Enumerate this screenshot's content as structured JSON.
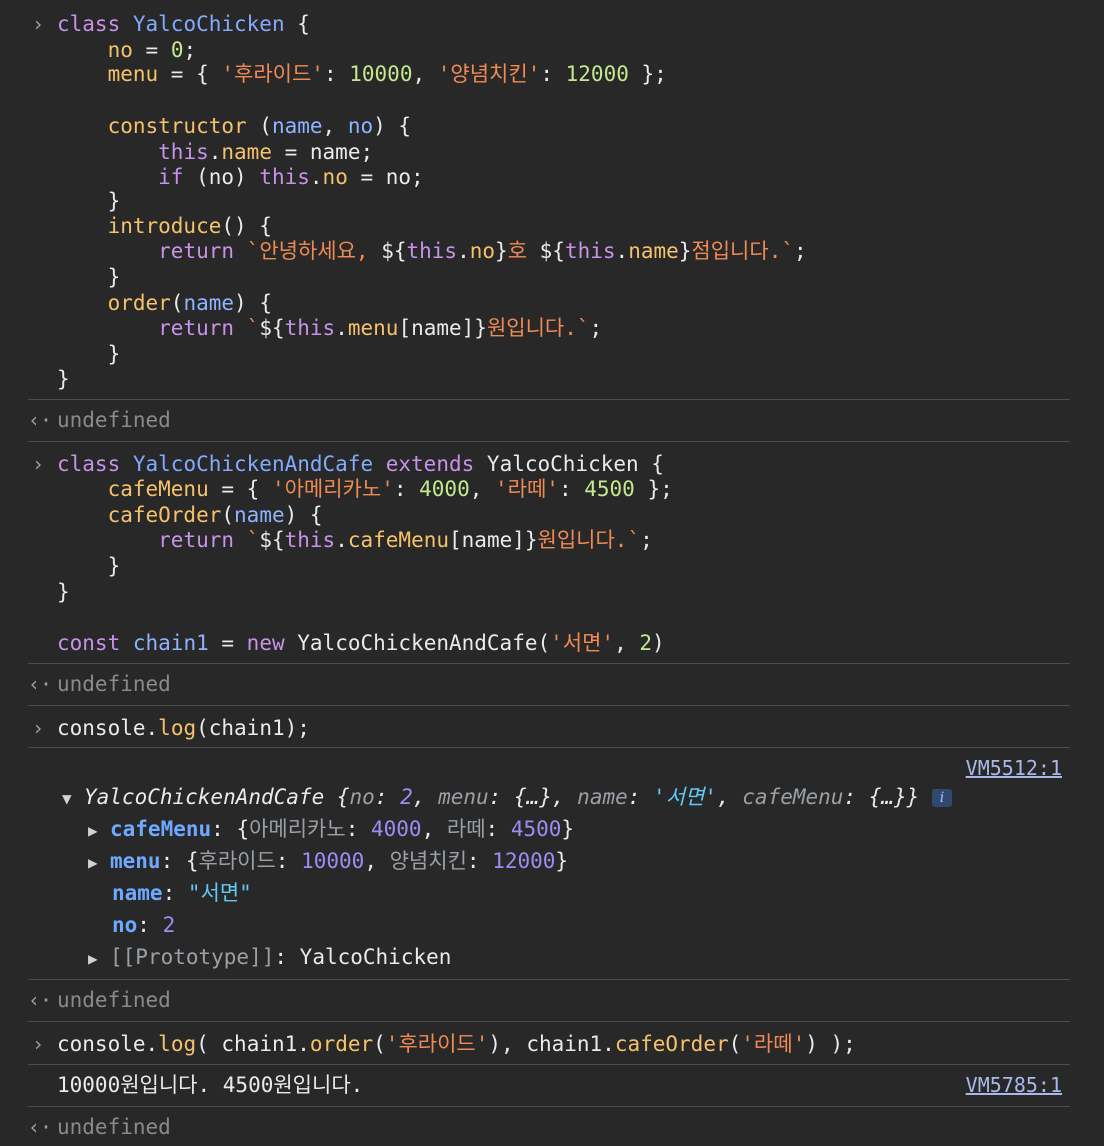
{
  "entry1": {
    "lines": [
      "class YalcoChicken {",
      "    no = 0;",
      "    menu = { '후라이드': 10000, '양념치킨': 12000 };",
      "",
      "    constructor (name, no) {",
      "        this.name = name;",
      "        if (no) this.no = no;",
      "    }",
      "    introduce() {",
      "        return `안녕하세요, ${this.no}호 ${this.name}점입니다.`;",
      "    }",
      "    order(name) {",
      "        return `${this.menu[name]}원입니다.`;",
      "    }",
      "}"
    ],
    "result": "undefined"
  },
  "entry2": {
    "lines": [
      "class YalcoChickenAndCafe extends YalcoChicken {",
      "    cafeMenu = { '아메리카노': 4000, '라떼': 4500 };",
      "    cafeOrder(name) {",
      "        return `${this.cafeMenu[name]}원입니다.`;",
      "    }",
      "}",
      "",
      "const chain1 = new YalcoChickenAndCafe('서면', 2)"
    ],
    "result": "undefined"
  },
  "entry3": {
    "command": "console.log(chain1);",
    "source": "VM5512:1",
    "object": {
      "class_name": "YalcoChickenAndCafe",
      "preview_no_key": "no",
      "preview_no_val": "2",
      "preview_menu_key": "menu",
      "preview_menu_val": "{…}",
      "preview_name_key": "name",
      "preview_name_val": "'서면'",
      "preview_cafe_key": "cafeMenu",
      "preview_cafe_val": "{…}",
      "props": {
        "cafeMenu_key": "cafeMenu",
        "cafeMenu_k1": "아메리카노",
        "cafeMenu_v1": "4000",
        "cafeMenu_k2": "라떼",
        "cafeMenu_v2": "4500",
        "menu_key": "menu",
        "menu_k1": "후라이드",
        "menu_v1": "10000",
        "menu_k2": "양념치킨",
        "menu_v2": "12000",
        "name_key": "name",
        "name_val": "\"서면\"",
        "no_key": "no",
        "no_val": "2",
        "proto_key": "[[Prototype]]",
        "proto_val": "YalcoChicken"
      },
      "info_icon": "i"
    },
    "result": "undefined"
  },
  "entry4": {
    "command": "console.log( chain1.order('후라이드'), chain1.cafeOrder('라떼') );",
    "output": "10000원입니다. 4500원입니다.",
    "source": "VM5785:1",
    "result": "undefined"
  },
  "glyphs": {
    "prompt": "›",
    "result": "‹·",
    "expanded": "▼",
    "collapsed": "▶"
  }
}
